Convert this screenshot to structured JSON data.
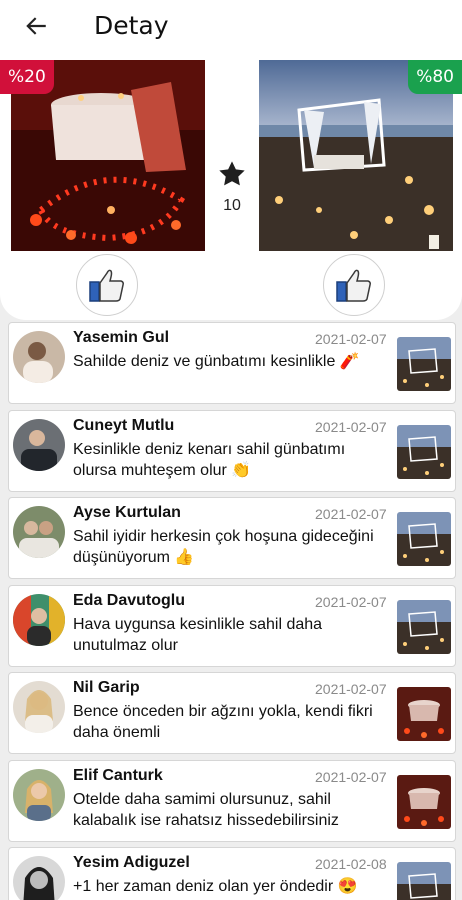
{
  "appbar": {
    "back_icon": "arrow-left-icon",
    "title": "Detay"
  },
  "comparison": {
    "left": {
      "badge": "%20",
      "badge_color": "#d1103a",
      "image": "romantic candlelit dinner table with candle heart",
      "like_icon": "thumbs-up-icon"
    },
    "right": {
      "badge": "%80",
      "badge_color": "#1aa14e",
      "image": "beach gazebo with lanterns at sunset",
      "like_icon": "thumbs-up-icon"
    },
    "star_icon": "star-icon",
    "star_count": "10"
  },
  "comments": [
    {
      "name": "Yasemin Gul",
      "date": "2021-02-07",
      "text": "Sahilde deniz ve günbatımı kesinlikle 🧨",
      "choice": "beach"
    },
    {
      "name": "Cuneyt Mutlu",
      "date": "2021-02-07",
      "text": "Kesinlikle deniz kenarı sahil günbatımı olursa muhteşem olur 👏",
      "choice": "beach"
    },
    {
      "name": "Ayse Kurtulan",
      "date": "2021-02-07",
      "text": "Sahil iyidir herkesin çok hoşuna gideceğini düşünüyorum 👍",
      "choice": "beach"
    },
    {
      "name": "Eda Davutoglu",
      "date": "2021-02-07",
      "text": "Hava uygunsa kesinlikle sahil daha unutulmaz olur",
      "choice": "beach"
    },
    {
      "name": "Nil Garip",
      "date": "2021-02-07",
      "text": "Bence önceden bir ağzını yokla, kendi fikri daha önemli",
      "choice": "dinner"
    },
    {
      "name": "Elif Canturk",
      "date": "2021-02-07",
      "text": "Otelde daha samimi olursunuz, sahil kalabalık ise rahatsız hissedebilirsiniz",
      "choice": "dinner"
    },
    {
      "name": "Yesim Adiguzel",
      "date": "2021-02-08",
      "text": "+1 her zaman deniz olan yer öndedir 😍",
      "choice": "beach"
    }
  ]
}
